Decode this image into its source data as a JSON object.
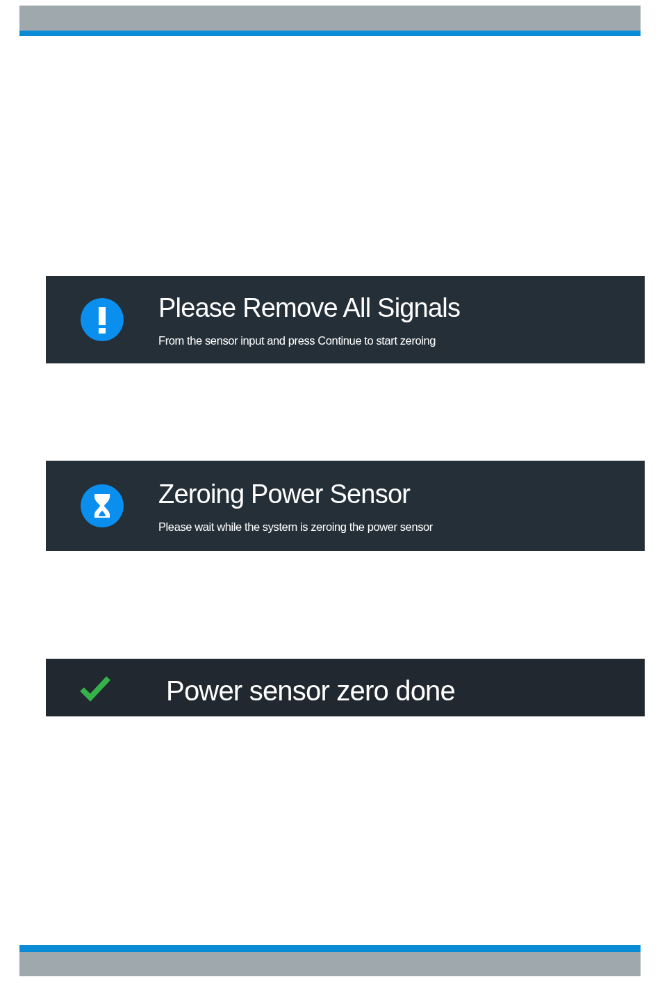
{
  "messages": [
    {
      "kind": "warning",
      "title": "Please Remove All Signals",
      "subtitle": "From the sensor input and press Continue to start zeroing"
    },
    {
      "kind": "busy",
      "title": "Zeroing Power Sensor",
      "subtitle": "Please wait while the system is zeroing the power sensor"
    },
    {
      "kind": "done",
      "title": "Power sensor zero done"
    }
  ]
}
